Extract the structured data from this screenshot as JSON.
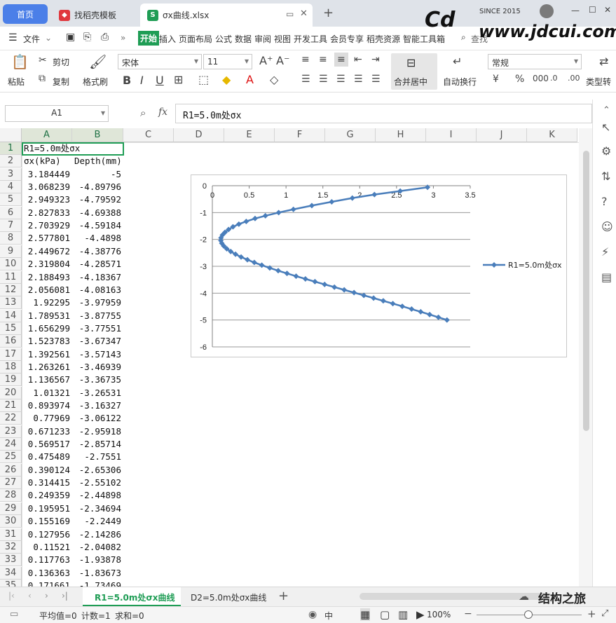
{
  "tabs": {
    "home": "首页",
    "template": "找稻壳模板",
    "file": "σx曲线.xlsx"
  },
  "watermark": {
    "since": "SINCE 2015",
    "site": "www.jdcui.com",
    "logo": "Cd"
  },
  "menu": {
    "file": "文件",
    "items": [
      "开始",
      "插入",
      "页面布局",
      "公式",
      "数据",
      "审阅",
      "视图",
      "开发工具",
      "会员专享",
      "稻壳资源",
      "智能工具箱"
    ],
    "search": "查找"
  },
  "ribbon": {
    "paste": "粘贴",
    "cut": "剪切",
    "copy": "复制",
    "format_painter": "格式刷",
    "font_name": "宋体",
    "font_size": "11",
    "merge_center": "合并居中",
    "wrap_text": "自动换行",
    "number_format": "常规",
    "type_convert": "类型转"
  },
  "formula_bar": {
    "name_box": "A1",
    "fx": "fx",
    "content": "R1=5.0m处σx"
  },
  "columns": [
    "A",
    "B",
    "C",
    "D",
    "E",
    "F",
    "G",
    "H",
    "I",
    "J",
    "K"
  ],
  "rows": [
    [
      "R1=5.0m处σx",
      ""
    ],
    [
      "σx(kPa)",
      "Depth(mm)"
    ],
    [
      "3.184449",
      "-5"
    ],
    [
      "3.068239",
      "-4.89796"
    ],
    [
      "2.949323",
      "-4.79592"
    ],
    [
      "2.827833",
      "-4.69388"
    ],
    [
      "2.703929",
      "-4.59184"
    ],
    [
      "2.577801",
      "-4.4898"
    ],
    [
      "2.449672",
      "-4.38776"
    ],
    [
      "2.319804",
      "-4.28571"
    ],
    [
      "2.188493",
      "-4.18367"
    ],
    [
      "2.056081",
      "-4.08163"
    ],
    [
      "1.92295",
      "-3.97959"
    ],
    [
      "1.789531",
      "-3.87755"
    ],
    [
      "1.656299",
      "-3.77551"
    ],
    [
      "1.523783",
      "-3.67347"
    ],
    [
      "1.392561",
      "-3.57143"
    ],
    [
      "1.263261",
      "-3.46939"
    ],
    [
      "1.136567",
      "-3.36735"
    ],
    [
      "1.01321",
      "-3.26531"
    ],
    [
      "0.893974",
      "-3.16327"
    ],
    [
      "0.77969",
      "-3.06122"
    ],
    [
      "0.671233",
      "-2.95918"
    ],
    [
      "0.569517",
      "-2.85714"
    ],
    [
      "0.475489",
      "-2.7551"
    ],
    [
      "0.390124",
      "-2.65306"
    ],
    [
      "0.314415",
      "-2.55102"
    ],
    [
      "0.249359",
      "-2.44898"
    ],
    [
      "0.195951",
      "-2.34694"
    ],
    [
      "0.155169",
      "-2.2449"
    ],
    [
      "0.127956",
      "-2.14286"
    ],
    [
      "0.11521",
      "-2.04082"
    ],
    [
      "0.117763",
      "-1.93878"
    ],
    [
      "0.136363",
      "-1.83673"
    ],
    [
      "0.171661",
      "-1.73469"
    ]
  ],
  "sheets": [
    "R1=5.0m处σx曲线",
    "D2=5.0m处σx曲线"
  ],
  "status": {
    "average": "平均值=0",
    "count": "计数=1",
    "sum": "求和=0",
    "ime": "中",
    "zoom": "100%",
    "wechat": "结构之旅"
  },
  "chart_data": {
    "type": "scatter",
    "series": [
      {
        "name": "R1=5.0m处σx",
        "color": "#4a7ebb",
        "x": [
          3.184449,
          3.068239,
          2.949323,
          2.827833,
          2.703929,
          2.577801,
          2.449672,
          2.319804,
          2.188493,
          2.056081,
          1.92295,
          1.789531,
          1.656299,
          1.523783,
          1.392561,
          1.263261,
          1.136567,
          1.01321,
          0.893974,
          0.77969,
          0.671233,
          0.569517,
          0.475489,
          0.390124,
          0.314415,
          0.249359,
          0.195951,
          0.155169,
          0.127956,
          0.11521,
          0.117763,
          0.136363,
          0.171661,
          0.22,
          0.28,
          0.36,
          0.46,
          0.58,
          0.72,
          0.9,
          1.1,
          1.35,
          1.62,
          1.9,
          2.2,
          2.55,
          2.92
        ],
        "y": [
          -5,
          -4.89796,
          -4.79592,
          -4.69388,
          -4.59184,
          -4.4898,
          -4.38776,
          -4.28571,
          -4.18367,
          -4.08163,
          -3.97959,
          -3.87755,
          -3.77551,
          -3.67347,
          -3.57143,
          -3.46939,
          -3.36735,
          -3.26531,
          -3.16327,
          -3.06122,
          -2.95918,
          -2.85714,
          -2.7551,
          -2.65306,
          -2.55102,
          -2.44898,
          -2.34694,
          -2.2449,
          -2.14286,
          -2.04082,
          -1.93878,
          -1.83673,
          -1.73469,
          -1.63,
          -1.53,
          -1.43,
          -1.33,
          -1.22,
          -1.12,
          -1.0,
          -0.88,
          -0.74,
          -0.6,
          -0.46,
          -0.33,
          -0.2,
          -0.06
        ]
      }
    ],
    "x_ticks": [
      "0",
      "0.5",
      "1",
      "1.5",
      "2",
      "2.5",
      "3",
      "3.5"
    ],
    "y_ticks": [
      "0",
      "-1",
      "-2",
      "-3",
      "-4",
      "-5",
      "-6"
    ],
    "xlim": [
      0,
      3.5
    ],
    "ylim": [
      -6,
      0
    ],
    "grid": "horizontal",
    "legend": "right",
    "legend_label": "R1=5.0m处σx"
  }
}
